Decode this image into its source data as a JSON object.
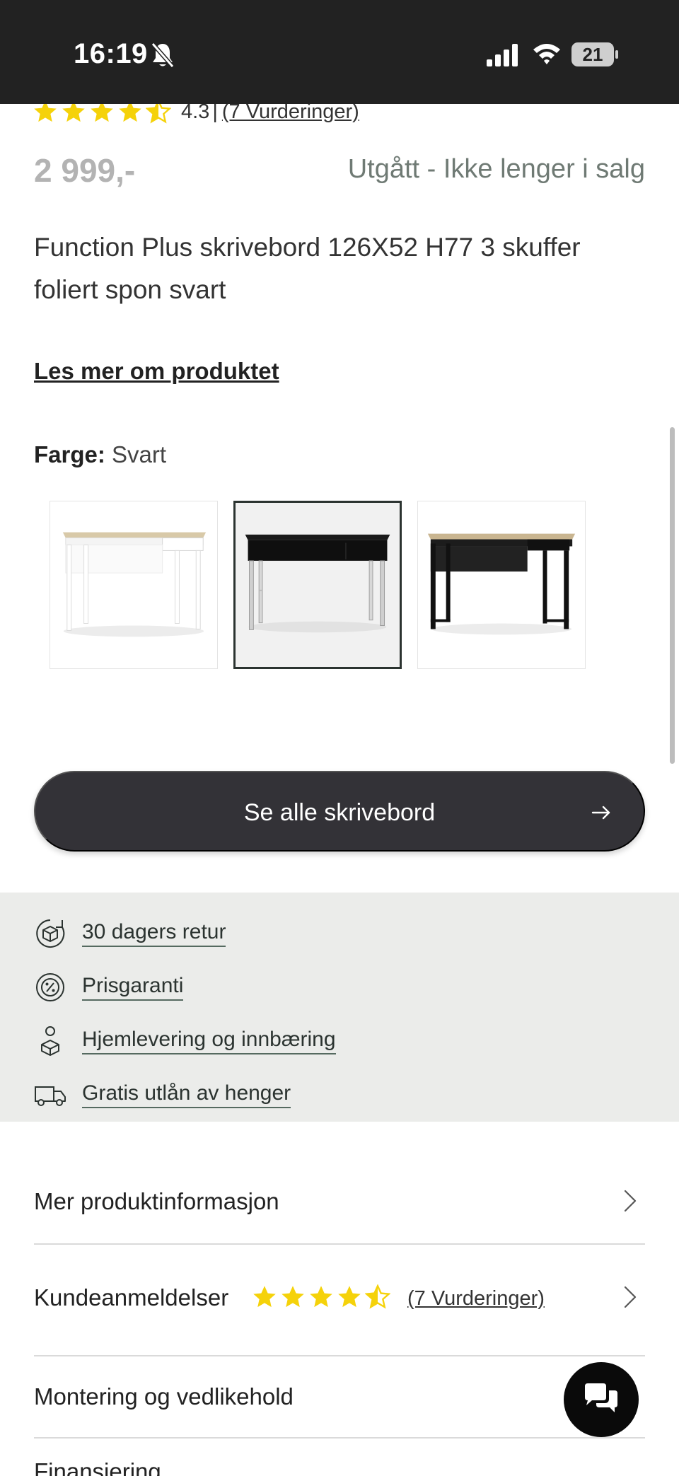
{
  "status_bar": {
    "time": "16:19",
    "battery": "21"
  },
  "rating_summary": {
    "score": "4.3",
    "separator": "|",
    "reviews_link": "(7 Vurderinger)",
    "rating_value": 4.3
  },
  "product": {
    "price": "2 999,-",
    "availability": "Utgått - Ikke lenger i salg",
    "title": "Function Plus skrivebord 126X52 H77 3 skuffer foliert spon svart",
    "read_more": "Les mer om produktet"
  },
  "color": {
    "label": "Farge:",
    "value": "Svart"
  },
  "cta": {
    "label": "Se alle skrivebord"
  },
  "usps": [
    {
      "icon": "box-return-icon",
      "label": "30 dagers retur"
    },
    {
      "icon": "price-guarantee-icon",
      "label": "Prisgaranti"
    },
    {
      "icon": "home-delivery-icon",
      "label": "Hjemlevering og innbæring"
    },
    {
      "icon": "truck-trailer-icon",
      "label": "Gratis utlån av henger"
    }
  ],
  "accordion": [
    {
      "title": "Mer produktinformasjon"
    },
    {
      "title": "Kundeanmeldelser",
      "reviews_link": "(7 Vurderinger)"
    },
    {
      "title": "Montering og vedlikehold"
    },
    {
      "title": "Finansiering"
    }
  ],
  "colors": {
    "star": "#f5d20a",
    "cta_bg": "#333237",
    "usp_bg": "#ebecea",
    "availability": "#6f7a74"
  }
}
